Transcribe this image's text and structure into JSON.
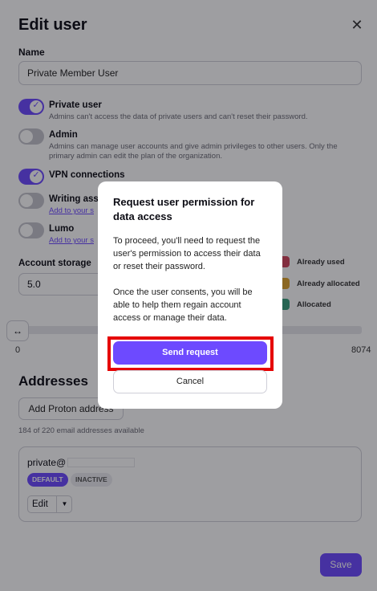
{
  "dialog": {
    "title": "Edit user",
    "close_icon": "close-icon",
    "name_label": "Name",
    "name_value": "Private Member User",
    "toggles": [
      {
        "title": "Private user",
        "description": "Admins can't access the data of private users and can't reset their password.",
        "on": true
      },
      {
        "title": "Admin",
        "description": "Admins can manage user accounts and give admin privileges to other users. Only the primary admin can edit the plan of the organization.",
        "on": false
      },
      {
        "title": "VPN connections",
        "on": true
      },
      {
        "title": "Writing ass",
        "link": "Add to your s",
        "on": false
      },
      {
        "title": "Lumo",
        "link": "Add to your s",
        "on": false
      }
    ],
    "storage": {
      "label": "Account storage",
      "value": "5.0",
      "legend": [
        {
          "label": "Already used",
          "color": "#d0455c"
        },
        {
          "label": "Already allocated",
          "color": "#e0a32c"
        },
        {
          "label": "Allocated",
          "color": "#3aa17e"
        }
      ],
      "slider_min": "0",
      "slider_max": "8074",
      "handle_icon": "↔"
    },
    "addresses": {
      "title": "Addresses",
      "add_button": "Add Proton address",
      "available": "184 of 220 email addresses available",
      "items": [
        {
          "email": "private@",
          "badges": [
            "DEFAULT",
            "INACTIVE"
          ],
          "edit_label": "Edit"
        }
      ]
    },
    "save_label": "Save"
  },
  "modal": {
    "title": "Request user permission for data access",
    "body_1": "To proceed, you'll need to request the user's permission to access their data or reset their password.",
    "body_2": "Once the user consents, you will be able to help them regain account access or manage their data.",
    "send_label": "Send request",
    "cancel_label": "Cancel"
  },
  "colors": {
    "accent": "#6d4aff",
    "highlight": "#e50000"
  }
}
